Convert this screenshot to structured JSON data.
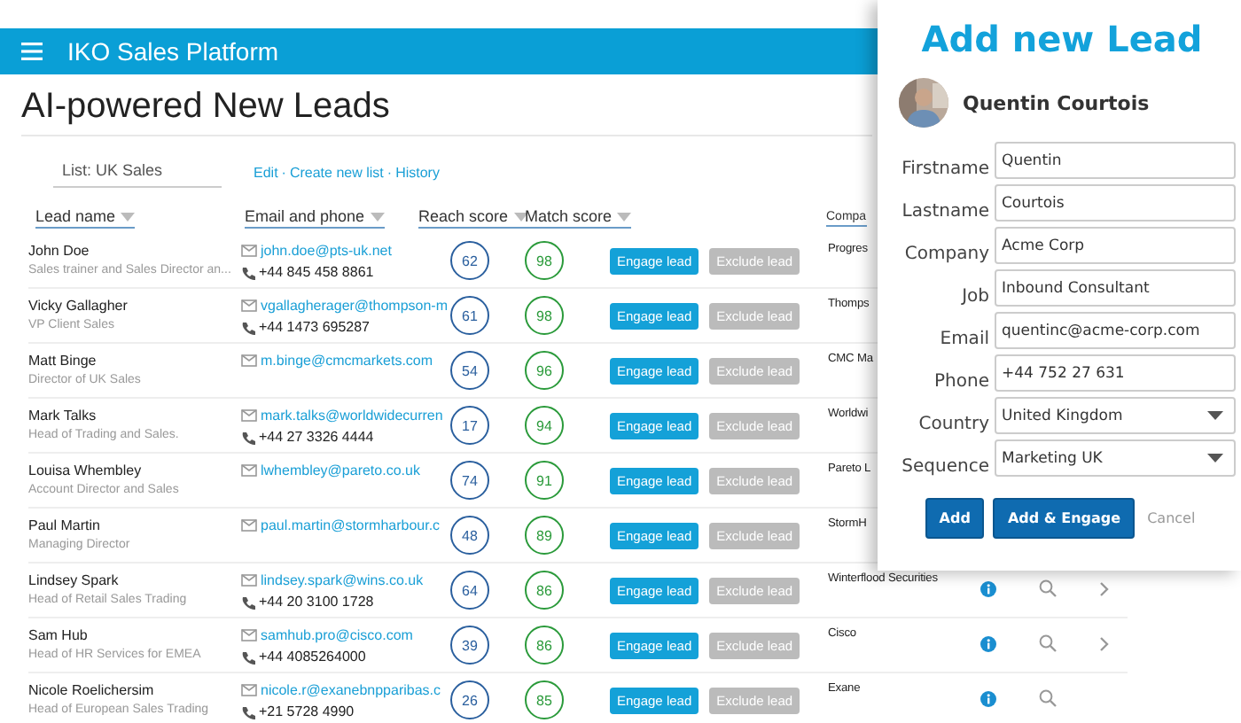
{
  "app_bar": {
    "title": "IKO Sales Platform"
  },
  "page_title": "AI-powered New Leads",
  "list_selector": {
    "value": "List: UK Sales"
  },
  "list_links": [
    "Edit",
    "Create new list",
    "History"
  ],
  "link_separator": "·",
  "columns": [
    "Lead name",
    "Email and phone",
    "Reach score",
    "Match score",
    "Compa"
  ],
  "rows": [
    {
      "name": "John Doe",
      "title": "Sales trainer and Sales Director an...",
      "email": "john.doe@pts-uk.net",
      "phone": "+44 845 458 8861",
      "reach": "62",
      "match": "98",
      "company": "Progres",
      "engage": "Engage lead",
      "exclude": "Exclude lead"
    },
    {
      "name": "Vicky Gallagher",
      "title": "VP Client Sales",
      "email": "vgallagherager@thompson-m",
      "phone": "+44 1473 695287",
      "reach": "61",
      "match": "98",
      "company": "Thomps",
      "engage": "Engage lead",
      "exclude": "Exclude lead"
    },
    {
      "name": "Matt Binge",
      "title": "Director of UK Sales",
      "email": "m.binge@cmcmarkets.com",
      "reach": "54",
      "match": "96",
      "company": "CMC Ma",
      "engage": "Engage lead",
      "exclude": "Exclude lead"
    },
    {
      "name": "Mark Talks",
      "title": "Head of Trading and Sales.",
      "email": "mark.talks@worldwidecurren",
      "phone": "+44 27 3326 4444",
      "reach": "17",
      "match": "94",
      "company": "Worldwi",
      "engage": "Engage lead",
      "exclude": "Exclude lead"
    },
    {
      "name": "Louisa Whembley",
      "title": "Account Director and Sales",
      "email": "lwhembley@pareto.co.uk",
      "reach": "74",
      "match": "91",
      "company": "Pareto L",
      "engage": "Engage lead",
      "exclude": "Exclude lead"
    },
    {
      "name": "Paul Martin",
      "title": "Managing Director",
      "email": "paul.martin@stormharbour.c",
      "reach": "48",
      "match": "89",
      "company": "StormH",
      "engage": "Engage lead",
      "exclude": "Exclude lead"
    },
    {
      "name": "Lindsey Spark",
      "title": "Head of Retail Sales Trading",
      "email": "lindsey.spark@wins.co.uk",
      "phone": "+44 20 3100 1728",
      "reach": "64",
      "match": "86",
      "company": "Winterflood Securities",
      "engage": "Engage lead",
      "exclude": "Exclude lead",
      "tools_shown": true,
      "chevron": true
    },
    {
      "name": "Sam Hub",
      "title": "Head of HR Services for EMEA",
      "email": "samhub.pro@cisco.com",
      "phone": "+44 4085264000",
      "reach": "39",
      "match": "86",
      "company": "Cisco",
      "engage": "Engage lead",
      "exclude": "Exclude lead",
      "tools_shown": true,
      "chevron": true
    },
    {
      "name": "Nicole Roelichersim",
      "title": "Head of European Sales Trading",
      "email": "nicole.r@exanebnpparibas.c",
      "phone": "+21 5728 4990",
      "reach": "26",
      "match": "85",
      "company": "Exane",
      "engage": "Engage lead",
      "exclude": "Exclude lead",
      "tools_shown": true,
      "chevron": false
    }
  ],
  "panel": {
    "title": "Add new Lead",
    "contact_name": "Quentin Courtois",
    "fields": [
      {
        "label": "Firstname",
        "value": "Quentin",
        "kind": "text"
      },
      {
        "label": "Lastname",
        "value": "Courtois",
        "kind": "text"
      },
      {
        "label": "Company",
        "value": "Acme Corp",
        "kind": "text"
      },
      {
        "label": "Job",
        "value": "Inbound Consultant",
        "kind": "text"
      },
      {
        "label": "Email",
        "value": "quentinc@acme-corp.com",
        "kind": "text"
      },
      {
        "label": "Phone",
        "value": "+44 752 27 631",
        "kind": "text"
      },
      {
        "label": "Country",
        "value": "United Kingdom",
        "kind": "select"
      },
      {
        "label": "Sequence",
        "value": "Marketing UK",
        "kind": "select"
      }
    ],
    "buttons": [
      {
        "label": "Add",
        "kind": "primary"
      },
      {
        "label": "Add & Engage",
        "kind": "primary"
      },
      {
        "label": "Cancel",
        "kind": "link"
      }
    ]
  }
}
